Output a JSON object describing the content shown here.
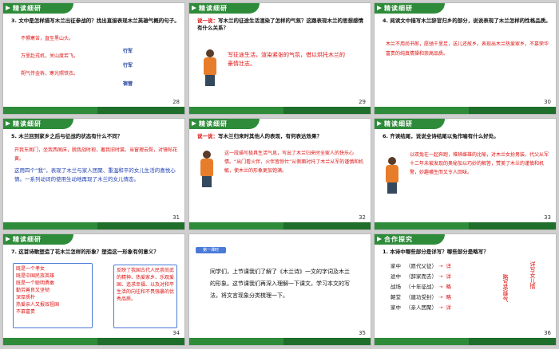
{
  "slides": [
    {
      "page": "28",
      "header": "精读细研",
      "q": "3. 文中是怎样描写木兰出征参战的？找出直接表现木兰英雄气概的句子。",
      "lines": [
        "不惧寒苦，直至黑山头。",
        "万里赴戎机，关山度若飞。",
        "朔气传金柝，寒光照铁衣。"
      ],
      "tags": [
        "行军",
        "行军",
        "宿营"
      ]
    },
    {
      "page": "29",
      "header": "精读细研",
      "say": "说一说：",
      "q": "写木兰的征途生活渲染了怎样的气氛？这跟表现木兰的思想感情有什么关系？",
      "answer": "写征途生活，渲染紧张的气氛，借以烘托木兰的豪情壮志。"
    },
    {
      "page": "30",
      "header": "精读细研",
      "q": "4. 阅读文中描写木兰辞官归乡的部分，说说表现了木兰怎样的性格品质。",
      "answer": "木兰不用尚书郎，愿驰千里足，送儿还故乡。表现出木兰热爱家乡，不慕荣华富贵的纯真情操和崇高品质。"
    },
    {
      "page": "31",
      "header": "精读细研",
      "q": "5. 木兰回到家乡之后与征战的状态有什么不同？",
      "answer": "开我东阁门，坐我西阁床，脱我战时袍，著我旧时裳。当窗理云鬓，对镜帖花黄。",
      "note": "这用四个“我”，表现了木兰与家人团聚、重温和平的女儿生活的喜悦心情。一系列动词的使用生动地再现了木兰的女儿情态。"
    },
    {
      "page": "32",
      "header": "精读细研",
      "say": "说一说：",
      "q": "写木兰归来时其他人的表现，有何表达效果？",
      "answer": "这一段描写极具生活气息，写出了木兰归来时全家人的快乐心情。“出门看火伴，火伴皆惊忙”从侧面衬托了木兰从军的谨慎和机敏，使木兰的形象更加饱满。"
    },
    {
      "page": "33",
      "header": "精读细研",
      "q": "6. 齐读结尾，说说全诗结尾以兔作喻有什么好处。",
      "answer": "以双兔在一起奔跑，难辨雌雄的比喻，对木兰女扮男装、代父从军十二年未被发现的奥秘加以巧妙的解答，赞美了木兰的谨慎和机警，妙趣横生而又令人回味。"
    },
    {
      "page": "34",
      "header": "精读细研",
      "q": "7. 这首诗歌塑造了花木兰怎样的形象？塑造这一形象有何意义？",
      "left": [
        "既是一个孝女",
        "既是中国民族英雄",
        "既是一个聪明勇敢",
        "勤劳善良又坚韧",
        "深厚质朴",
        "热爱亲人又报效祖国",
        "不慕富贵"
      ],
      "right": "反映了我国古代人民崇尚武的精神、热爱家乡、乐观爱国、追求幸福、以及对和平生活的向往和不畏强暴的优秀品质。"
    },
    {
      "page": "35",
      "header": "",
      "lesson": "第一课时",
      "text": "同学们，上节课我们了解了《木兰诗》一文的字词及木兰的形象。这节课我们再深入理解一下课文，学习本文的写法，将文言现象分类梳理一下。"
    },
    {
      "page": "36",
      "header": "合作探究",
      "q": "1. 本诗中哪些部分是详写？哪些部分是略写？",
      "rows": [
        {
          "a": "家中",
          "b": "（愿代父征）",
          "c": "详"
        },
        {
          "a": "途中",
          "b": "（辞家而去）",
          "c": "详"
        },
        {
          "a": "战场",
          "b": "（十年征战）",
          "c": "略"
        },
        {
          "a": "朝堂",
          "b": "（建功受封）",
          "c": "略"
        },
        {
          "a": "家中",
          "b": "（亲人团聚）",
          "c": "详"
        }
      ],
      "side1": "略写英雄气",
      "side2": "详写女儿情"
    }
  ]
}
